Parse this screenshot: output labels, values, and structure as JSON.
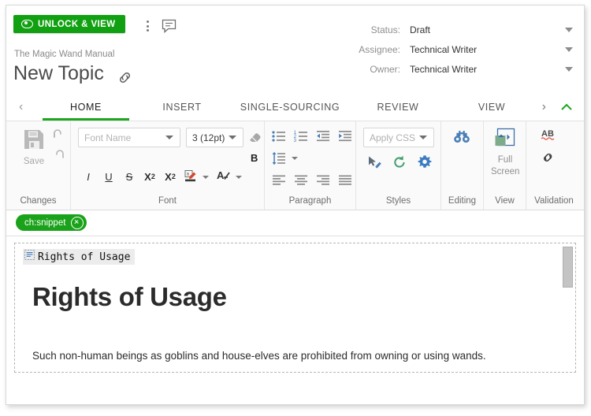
{
  "header": {
    "unlock_button": "UNLOCK & VIEW",
    "more_icon": "kebab-menu-icon",
    "comment_icon": "comment-icon",
    "breadcrumb": "The Magic Wand Manual",
    "title": "New Topic",
    "link_icon": "link-icon",
    "meta": [
      {
        "label": "Status:",
        "value": "Draft"
      },
      {
        "label": "Assignee:",
        "value": "Technical Writer"
      },
      {
        "label": "Owner:",
        "value": "Technical Writer"
      }
    ]
  },
  "ribbon": {
    "prev_icon": "chevron-left-icon",
    "next_icon": "chevron-right-icon",
    "collapse_icon": "chevron-up-icon",
    "tabs": [
      {
        "label": "HOME",
        "active": true
      },
      {
        "label": "INSERT",
        "active": false
      },
      {
        "label": "SINGLE-SOURCING",
        "active": false
      },
      {
        "label": "REVIEW",
        "active": false
      },
      {
        "label": "VIEW",
        "active": false
      }
    ],
    "groups": {
      "changes": {
        "label": "Changes",
        "save_label": "Save",
        "save_icon": "save-floppy-icon",
        "undo_icon": "undo-icon",
        "redo_icon": "redo-icon"
      },
      "font": {
        "label": "Font",
        "font_name_placeholder": "Font Name",
        "font_name_value": "",
        "font_size_value": "3 (12pt)",
        "clear_format_icon": "eraser-icon",
        "bold_label": "B",
        "italic_label": "I",
        "underline_label": "U",
        "strike_label": "S",
        "subscript_label": "X",
        "subscript_sup": "2",
        "superscript_label": "X",
        "superscript_sup": "2",
        "highlight_icon": "text-highlight-icon",
        "font_color_icon": "font-color-icon"
      },
      "paragraph": {
        "label": "Paragraph",
        "bullet_list_icon": "bullet-list-icon",
        "numbered_list_icon": "numbered-list-icon",
        "decrease_indent_icon": "decrease-indent-icon",
        "increase_indent_icon": "increase-indent-icon",
        "line_spacing_icon": "line-spacing-icon",
        "align_left_icon": "align-left-icon",
        "align_center_icon": "align-center-icon",
        "align_right_icon": "align-right-icon",
        "align_justify_icon": "align-justify-icon"
      },
      "styles": {
        "label": "Styles",
        "apply_css_placeholder": "Apply CSS",
        "apply_css_value": "",
        "format_painter_icon": "format-painter-icon",
        "refresh_styles_icon": "refresh-styles-icon",
        "style_settings_icon": "gear-icon"
      },
      "editing": {
        "label": "Editing",
        "find_replace_icon": "binoculars-icon"
      },
      "view": {
        "label": "View",
        "full_screen_label_1": "Full",
        "full_screen_label_2": "Screen",
        "full_screen_icon": "full-screen-icon"
      },
      "validation": {
        "label": "Validation",
        "spellcheck_label": "AB",
        "spellcheck_icon": "spellcheck-icon",
        "link_check_icon": "broken-link-icon"
      }
    }
  },
  "snippet_bar": {
    "chip_label": "ch:snippet",
    "chip_close_icon": "close-icon"
  },
  "editor": {
    "tag_glyph_icon": "paragraph-block-icon",
    "tag_text": "Rights of Usage",
    "heading": "Rights of Usage",
    "paragraph": "Such non-human beings as goblins and house-elves are prohibited from owning or using wands.",
    "scrollbar_icon": "vertical-scrollbar-thumb"
  },
  "colors": {
    "green": "#11a011",
    "chip_green": "#1aa31a",
    "tab_underline": "#1da51d",
    "icon_blue": "#4a7fb5",
    "muted": "#8f8f8f"
  }
}
